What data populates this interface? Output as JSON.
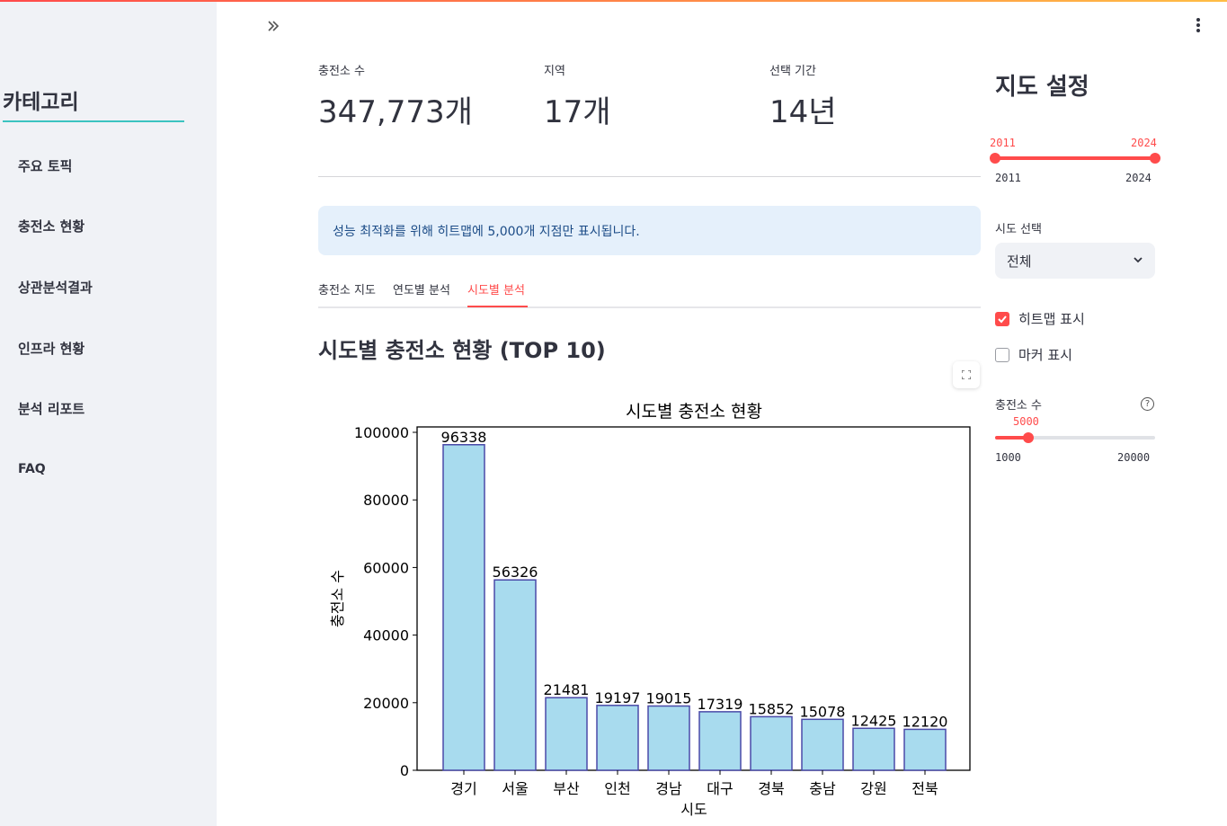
{
  "sidebar": {
    "title": "카테고리",
    "items": [
      {
        "label": "주요 토픽"
      },
      {
        "label": "충전소 현황"
      },
      {
        "label": "상관분석결과"
      },
      {
        "label": "인프라 현황"
      },
      {
        "label": "분석 리포트"
      },
      {
        "label": "FAQ"
      }
    ]
  },
  "metrics": [
    {
      "label": "충전소 수",
      "value": "347,773개"
    },
    {
      "label": "지역",
      "value": "17개"
    },
    {
      "label": "선택 기간",
      "value": "14년"
    }
  ],
  "info_message": "성능 최적화를 위해 히트맵에 5,000개 지점만 표시됩니다.",
  "tabs": [
    {
      "label": "충전소 지도"
    },
    {
      "label": "연도별 분석"
    },
    {
      "label": "시도별 분석",
      "active": true
    }
  ],
  "section_title": "시도별 충전소 현황 (TOP 10)",
  "settings": {
    "title": "지도 설정",
    "year_slider": {
      "value_min": "2011",
      "value_max": "2024",
      "min": "2011",
      "max": "2024"
    },
    "region_select": {
      "label": "시도 선택",
      "value": "전체"
    },
    "heatmap_checkbox": {
      "label": "히트맵 표시",
      "checked": true
    },
    "marker_checkbox": {
      "label": "마커 표시",
      "checked": false
    },
    "count_slider": {
      "label": "충전소 수",
      "value": "5000",
      "min": "1000",
      "max": "20000"
    }
  },
  "colors": {
    "accent": "#ff4b4b",
    "bar_fill": "#a8dbee",
    "bar_edge": "#4a4aa8"
  },
  "chart_data": {
    "type": "bar",
    "title": "시도별 충전소 현황",
    "xlabel": "시도",
    "ylabel": "충전소 수",
    "categories": [
      "경기",
      "서울",
      "부산",
      "인천",
      "경남",
      "대구",
      "경북",
      "충남",
      "강원",
      "전북"
    ],
    "values": [
      96338,
      56326,
      21481,
      19197,
      19015,
      17319,
      15852,
      15078,
      12425,
      12120
    ],
    "yticks": [
      "0",
      "20000",
      "40000",
      "60000",
      "80000",
      "100000"
    ],
    "ylim": [
      0,
      100000
    ],
    "grid": false
  }
}
